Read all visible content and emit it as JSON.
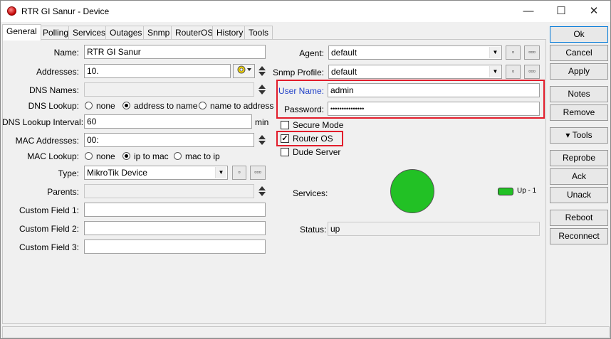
{
  "window": {
    "title": "RTR GI Sanur - Device",
    "minimize": "—",
    "maximize": "☐",
    "close": "✕"
  },
  "tabs": [
    "General",
    "Polling",
    "Services",
    "Outages",
    "Snmp",
    "RouterOS",
    "History",
    "Tools"
  ],
  "form": {
    "name_label": "Name:",
    "name_value": "RTR GI Sanur",
    "addresses_label": "Addresses:",
    "addresses_value": "10.",
    "dns_names_label": "DNS Names:",
    "dns_lookup_label": "DNS Lookup:",
    "dns_lookup_options": [
      "none",
      "address to name",
      "name to address"
    ],
    "dns_lookup_selected": "address to name",
    "dns_lookup_interval_label": "DNS Lookup Interval:",
    "dns_lookup_interval_value": "60",
    "dns_lookup_interval_unit": "min",
    "mac_addresses_label": "MAC Addresses:",
    "mac_addresses_value": "00:",
    "mac_lookup_label": "MAC Lookup:",
    "mac_lookup_options": [
      "none",
      "ip to mac",
      "mac to ip"
    ],
    "mac_lookup_selected": "ip to mac",
    "type_label": "Type:",
    "type_value": "MikroTik Device",
    "parents_label": "Parents:",
    "custom1_label": "Custom Field 1:",
    "custom2_label": "Custom Field 2:",
    "custom3_label": "Custom Field 3:",
    "small_btn": "▫",
    "dots_btn": "▫▫▫"
  },
  "right": {
    "agent_label": "Agent:",
    "agent_value": "default",
    "snmp_profile_label": "Snmp Profile:",
    "snmp_profile_value": "default",
    "user_name_label": "User Name:",
    "user_name_value": "admin",
    "password_label": "Password:",
    "password_value": "•••••••••••••••",
    "secure_mode_label": "Secure Mode",
    "secure_mode_checked": false,
    "router_os_label": "Router OS",
    "router_os_checked": true,
    "dude_server_label": "Dude Server",
    "dude_server_checked": false,
    "services_label": "Services:",
    "services_legend": "Up - 1",
    "status_label": "Status:",
    "status_value": "up"
  },
  "side_buttons": {
    "ok": "Ok",
    "cancel": "Cancel",
    "apply": "Apply",
    "notes": "Notes",
    "remove": "Remove",
    "tools": "▾ Tools",
    "reprobe": "Reprobe",
    "ack": "Ack",
    "unack": "Unack",
    "reboot": "Reboot",
    "reconnect": "Reconnect"
  },
  "colors": {
    "highlight_box": "#e21d2b",
    "status_up": "#22c125",
    "user_name_label_color": "#1f3fc7"
  }
}
